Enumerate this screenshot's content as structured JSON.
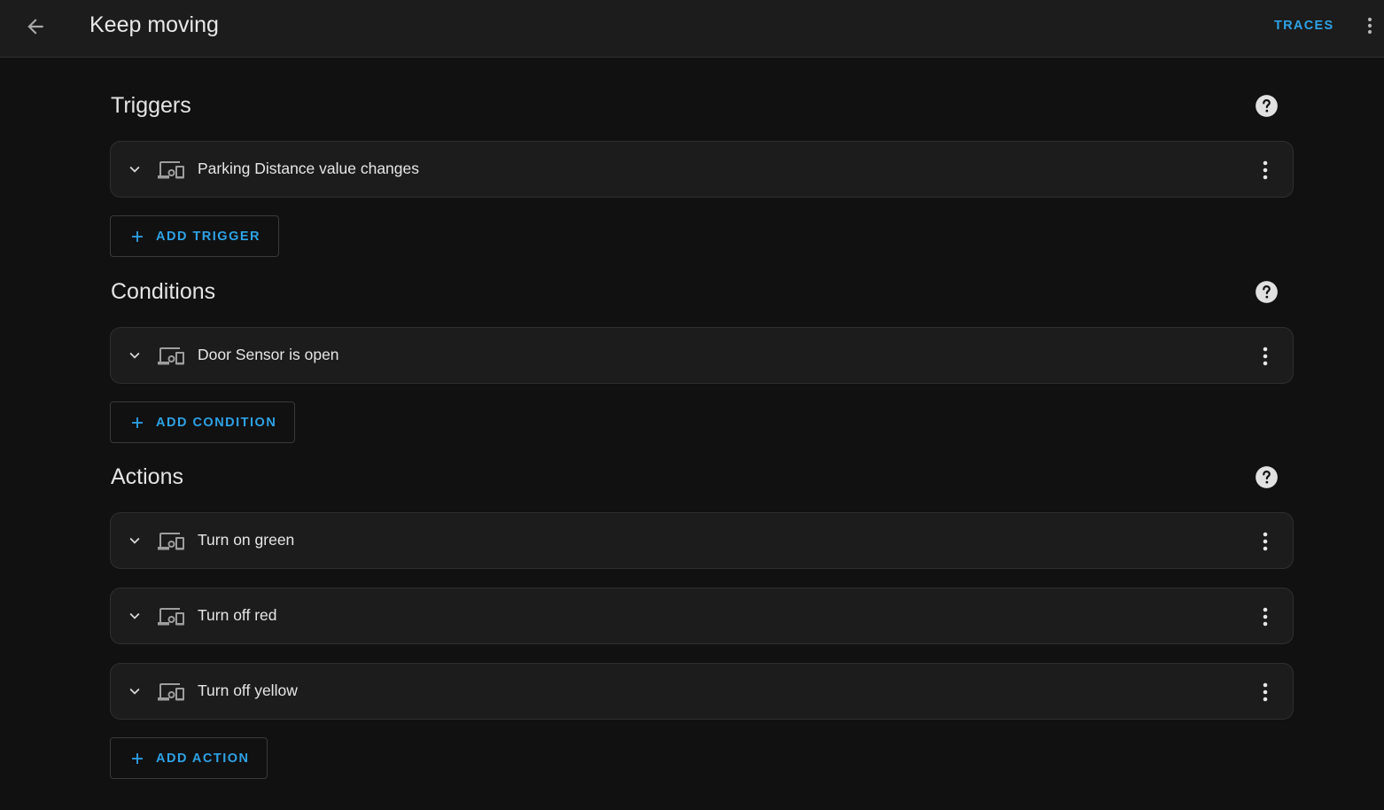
{
  "header": {
    "title": "Keep moving",
    "traces_label": "TRACES"
  },
  "sections": {
    "triggers": {
      "title": "Triggers",
      "items": [
        {
          "label": "Parking Distance value changes"
        }
      ],
      "add_label": "ADD TRIGGER"
    },
    "conditions": {
      "title": "Conditions",
      "items": [
        {
          "label": "Door Sensor is open"
        }
      ],
      "add_label": "ADD CONDITION"
    },
    "actions": {
      "title": "Actions",
      "items": [
        {
          "label": "Turn on green"
        },
        {
          "label": "Turn off red"
        },
        {
          "label": "Turn off yellow"
        }
      ],
      "add_label": "ADD ACTION"
    }
  },
  "colors": {
    "accent": "#2ea2e6",
    "background": "#111111",
    "card": "#1c1c1c"
  },
  "icons": {
    "back": "arrow-left-icon",
    "overflow": "dots-vertical-icon",
    "help": "help-circle-icon",
    "expand": "chevron-down-icon",
    "device": "devices-icon",
    "add": "plus-icon"
  }
}
